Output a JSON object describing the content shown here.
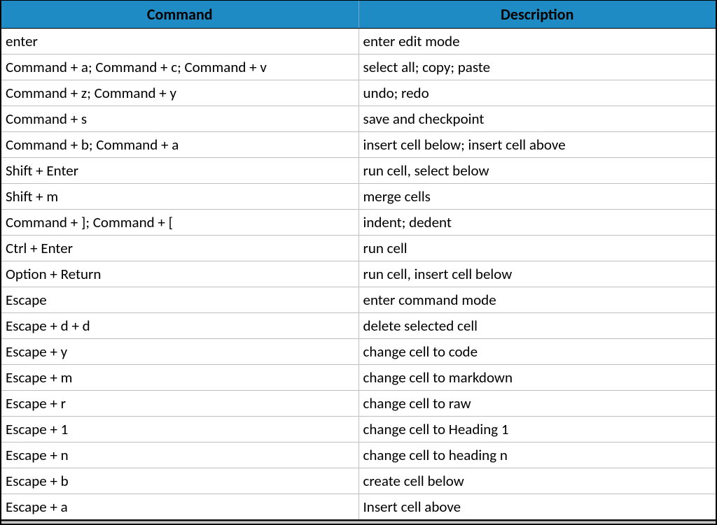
{
  "headers": {
    "command": "Command",
    "description": "Description"
  },
  "rows": [
    {
      "command": "enter",
      "description": "enter edit mode"
    },
    {
      "command": "Command + a; Command + c; Command + v",
      "description": "select all; copy; paste"
    },
    {
      "command": "Command + z; Command + y",
      "description": "undo; redo"
    },
    {
      "command": "Command + s",
      "description": "save and checkpoint"
    },
    {
      "command": "Command + b; Command + a",
      "description": "insert cell below; insert cell above"
    },
    {
      "command": "Shift + Enter",
      "description": "run cell, select below"
    },
    {
      "command": "Shift + m",
      "description": "merge cells"
    },
    {
      "command": "Command + ]; Command + [",
      "description": "indent; dedent"
    },
    {
      "command": "Ctrl + Enter",
      "description": "run cell"
    },
    {
      "command": "Option + Return",
      "description": "run cell, insert cell below"
    },
    {
      "command": "Escape",
      "description": "enter command mode"
    },
    {
      "command": "Escape + d + d",
      "description": "delete selected cell"
    },
    {
      "command": "Escape + y",
      "description": "change cell to code"
    },
    {
      "command": "Escape + m",
      "description": "change cell to markdown"
    },
    {
      "command": "Escape + r",
      "description": "change cell to raw"
    },
    {
      "command": "Escape + 1",
      "description": "change cell to Heading 1"
    },
    {
      "command": "Escape + n",
      "description": "change cell to heading n"
    },
    {
      "command": "Escape + b",
      "description": "create cell below"
    },
    {
      "command": "Escape + a",
      "description": "Insert cell above"
    }
  ]
}
